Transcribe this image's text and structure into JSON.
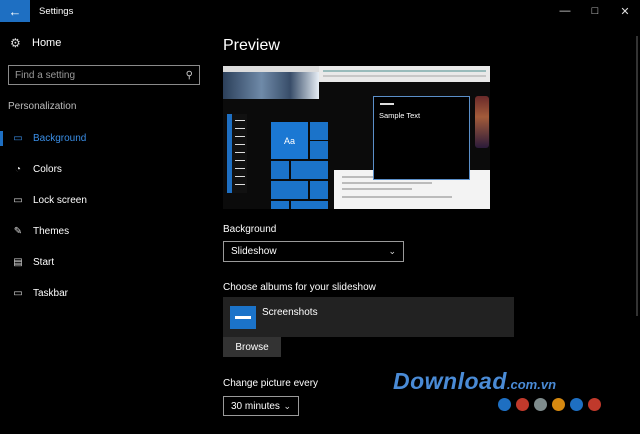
{
  "window": {
    "title": "Settings",
    "back_icon": "arrow-left-icon",
    "controls": [
      "—",
      "□",
      "✕"
    ]
  },
  "sidebar": {
    "home_label": "Home",
    "search_placeholder": "Find a setting",
    "section_label": "Personalization",
    "items": [
      {
        "label": "Background",
        "icon": "picture-icon",
        "glyph": "▭",
        "active": true
      },
      {
        "label": "Colors",
        "icon": "palette-icon",
        "glyph": "◔",
        "active": false
      },
      {
        "label": "Lock screen",
        "icon": "lock-screen-icon",
        "glyph": "▭",
        "active": false
      },
      {
        "label": "Themes",
        "icon": "brush-icon",
        "glyph": "✎",
        "active": false
      },
      {
        "label": "Start",
        "icon": "start-icon",
        "glyph": "▤",
        "active": false
      },
      {
        "label": "Taskbar",
        "icon": "taskbar-icon",
        "glyph": "▭",
        "active": false
      }
    ]
  },
  "main": {
    "preview_heading": "Preview",
    "preview_tile_label": "Aa",
    "preview_sample_text": "Sample Text",
    "background_label": "Background",
    "background_value": "Slideshow",
    "albums_label": "Choose albums for your slideshow",
    "album_name": "Screenshots",
    "browse_label": "Browse",
    "interval_label": "Change picture every",
    "interval_value": "30 minutes"
  },
  "watermark": {
    "brand": "Download",
    "suffix": ".com.vn",
    "dot_colors": [
      "#1e6fc2",
      "#c0392b",
      "#7f8c8d",
      "#d68910",
      "#1e6fc2",
      "#c0392b"
    ]
  },
  "colors": {
    "accent": "#1e6fc2",
    "active_text": "#3a8ee6",
    "background": "#000000"
  }
}
